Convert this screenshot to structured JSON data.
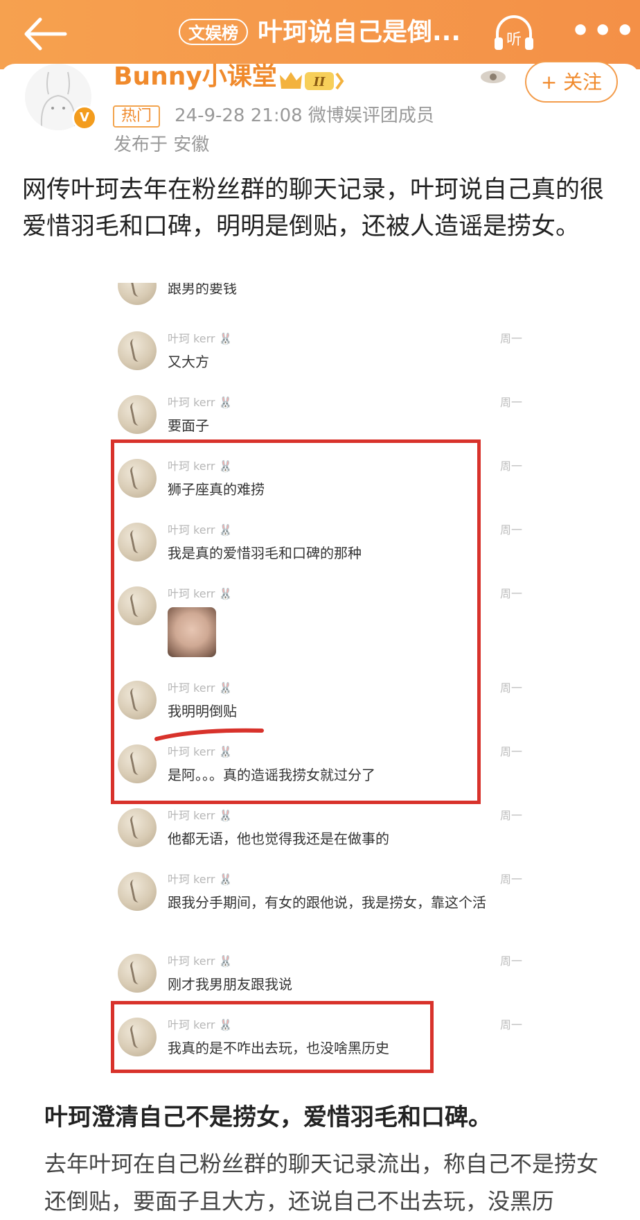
{
  "header": {
    "tag": "文娱榜",
    "title": "叶珂说自己是倒...",
    "listen_label": "听",
    "more_label": "•••"
  },
  "author": {
    "name": "Bunny小课堂",
    "level": "II",
    "follow_label": "+ 关注",
    "hot_badge": "热门",
    "meta": "24-9-28 21:08  微博娱评团成员",
    "location": "发布于 安徽"
  },
  "post": {
    "text": "网传叶珂去年在粉丝群的聊天记录，叶珂说自己真的很爱惜羽毛和口碑，明明是倒贴，还被人造谣是捞女。"
  },
  "chat": {
    "sender": "叶珂 kerr 🐰",
    "time": "周一",
    "messages": [
      {
        "text": "跟男的要钱",
        "show_header": false
      },
      {
        "text": "又大方",
        "show_header": true
      },
      {
        "text": "要面子",
        "show_header": true
      },
      {
        "text": "狮子座真的难捞",
        "show_header": true
      },
      {
        "text": "我是真的爱惜羽毛和口碑的那种",
        "show_header": true
      },
      {
        "text": "",
        "show_header": true,
        "sticker": true
      },
      {
        "text": "我明明倒贴",
        "show_header": true
      },
      {
        "text": "是阿。。。真的造谣我捞女就过分了",
        "show_header": true
      },
      {
        "text": "他都无语，他也觉得我还是在做事的",
        "show_header": true
      },
      {
        "text": "跟我分手期间，有女的跟他说，我是捞女，靠这个活",
        "show_header": true
      },
      {
        "text": "刚才我男朋友跟我说",
        "show_header": true
      },
      {
        "text": "我真的是不咋出去玩，也没啥黑历史",
        "show_header": true
      }
    ]
  },
  "article": {
    "heading": "叶珂澄清自己不是捞女，爱惜羽毛和口碑。",
    "body": "去年叶珂在自己粉丝群的聊天记录流出，称自己不是捞女还倒贴，要面子且大方，还说自己不出去玩，没黑历"
  }
}
